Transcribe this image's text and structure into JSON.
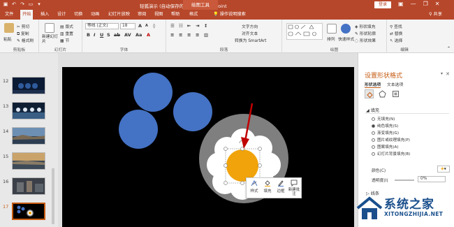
{
  "titlebar": {
    "doc_title": "轻狐演示 (自动保存的).pptx  -  PowerPoint",
    "context_tab": "绘图工具",
    "login": "登录",
    "minimize": "—",
    "restore": "❐",
    "close": "✕"
  },
  "menu": {
    "tabs": [
      "文件",
      "开始",
      "插入",
      "设计",
      "切换",
      "动画",
      "幻灯片放映",
      "审阅",
      "视图",
      "帮助",
      "格式"
    ],
    "active_tab": "开始",
    "tell_me": "操作说明搜索",
    "share": "共享"
  },
  "ribbon": {
    "clipboard": {
      "paste": "粘贴",
      "cut": "剪切",
      "copy": "复制",
      "format_painter": "格式刷",
      "label": "剪贴板"
    },
    "slides": {
      "new_slide": "新建幻灯片",
      "layout": "版式",
      "reset": "重置",
      "section": "节",
      "label": "幻灯片"
    },
    "font": {
      "font_name": "等线 (正文)",
      "font_size": "18",
      "label": "字体"
    },
    "paragraph": {
      "text_direction": "文字方向",
      "align_text": "对齐文本",
      "smartart": "转换为 SmartArt",
      "label": "段落"
    },
    "drawing": {
      "arrange": "排列",
      "quick_styles": "快速样式",
      "shape_fill": "形状填充",
      "shape_outline": "形状轮廓",
      "shape_effects": "形状效果",
      "label": "绘图"
    },
    "editing": {
      "find": "查找",
      "replace": "替换",
      "select": "选择",
      "label": "编辑"
    }
  },
  "thumbnails": [
    {
      "num": "12"
    },
    {
      "num": "13"
    },
    {
      "num": "14"
    },
    {
      "num": "15"
    },
    {
      "num": "16"
    },
    {
      "num": "17",
      "active": true
    }
  ],
  "minibar": {
    "style": "样式",
    "fill": "填充",
    "outline": "边框",
    "new_comment": "新建批注"
  },
  "pane": {
    "title": "设置形状格式",
    "tab_shape": "形状选项",
    "tab_text": "文本选项",
    "fill_section": "填充",
    "fill_options": [
      {
        "label": "无填充(N)",
        "selected": false
      },
      {
        "label": "纯色填充(S)",
        "selected": true
      },
      {
        "label": "渐变填充(G)",
        "selected": false
      },
      {
        "label": "图片或纹理填充(P)",
        "selected": false
      },
      {
        "label": "图案填充(A)",
        "selected": false
      },
      {
        "label": "幻灯片背景填充(B)",
        "selected": false
      }
    ],
    "color_label": "颜色(C)",
    "transparency_label": "透明度(I)",
    "transparency_value": "0%",
    "line_section": "线条"
  },
  "watermark": {
    "cn": "系统之家",
    "en": "XITONGZHIJIA.NET"
  },
  "colors": {
    "accent": "#b7472a",
    "circle_blue": "#4472c4",
    "orange": "#f0a30a",
    "gray": "#7f7f7f",
    "arrow": "#c00000"
  }
}
